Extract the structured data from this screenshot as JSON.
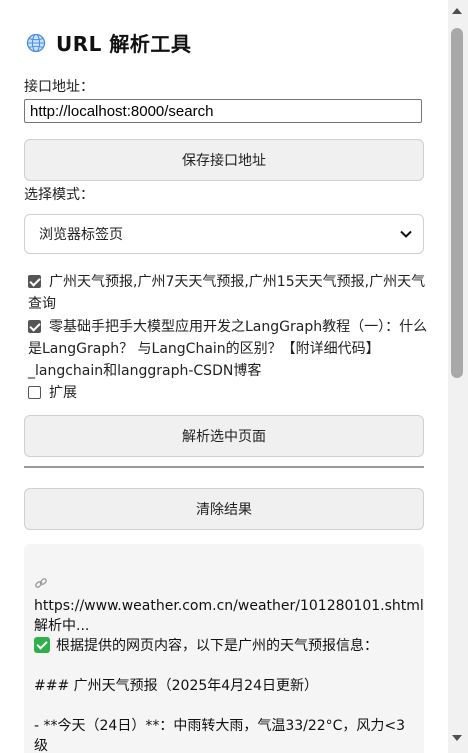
{
  "app": {
    "title": "URL 解析工具",
    "icon": "globe-icon"
  },
  "endpoint": {
    "label": "接口地址：",
    "value": "http://localhost:8000/search"
  },
  "buttons": {
    "save": "保存接口地址",
    "parse": "解析选中页面",
    "clear": "清除结果"
  },
  "mode": {
    "label": "选择模式：",
    "selected": "浏览器标签页"
  },
  "tabs": [
    {
      "label": "广州天气预报,广州7天天气预报,广州15天天气预报,广州天气查询",
      "checked": true
    },
    {
      "label": "零基础手把手大模型应用开发之LangGraph教程（一）：什么是LangGraph？ 与LangChain的区别？【附详细代码】_langchain和langgraph-CSDN博客",
      "checked": true
    },
    {
      "label": "扩展",
      "checked": false
    }
  ],
  "result": {
    "url": "https://www.weather.com.cn/weather/101280101.shtml",
    "status": "解析中...",
    "summary": "根据提供的网页内容，以下是广州的天气预报信息：",
    "heading": "### 广州天气预报（2025年4月24日更新）",
    "item1": "- **今天（24日）**：中雨转大雨，气温33/22°C，风力<3级"
  },
  "colors": {
    "checkbox": "#555555",
    "success": "#2fb04a",
    "button_bg": "#f0f0f0",
    "result_bg": "#f5f5f5"
  }
}
